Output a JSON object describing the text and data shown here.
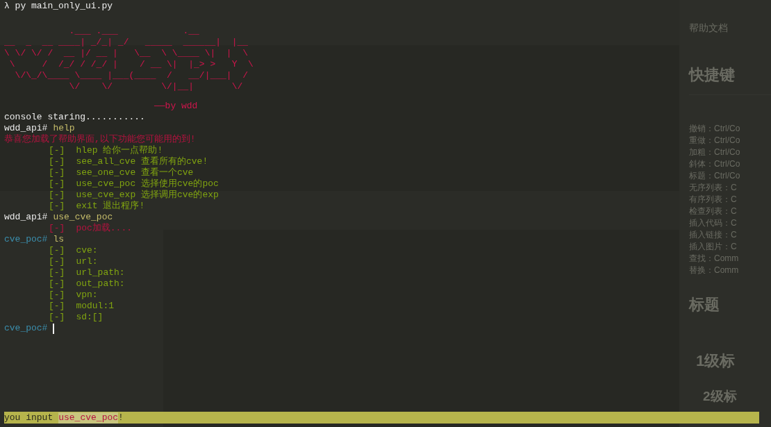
{
  "command": "λ py main_only_ui.py",
  "banner_art": [
    "            .___ .___            .__",
    "__  _  __ ____| _/_| _/   _____  ______|  |__",
    "\\ \\/ \\/ /  __ |/ __ |   \\__  \\ \\____ \\|  |  \\",
    " \\     /  /_/ / /_/ |    / __ \\|  |_> >   Y  \\",
    "  \\/\\_/\\____ \\____ |___(____  /   __/|___|  /",
    "            \\/    \\/         \\/|__|       \\/"
  ],
  "banner_credit": "——by wdd",
  "lines": [
    {
      "kind": "plain",
      "text": "console staring..........."
    },
    {
      "kind": "prompt",
      "color": "#ececec",
      "prompt": "wdd_api#",
      "input": "help"
    },
    {
      "kind": "notice",
      "text": "恭喜您加载了帮助界面,以下功能您可能用的到!"
    },
    {
      "kind": "item",
      "color": "#80a410",
      "marker": "[-]",
      "text": "hlep 给你一点帮助!"
    },
    {
      "kind": "item",
      "color": "#80a410",
      "marker": "[-]",
      "text": "see_all_cve 查看所有的cve!"
    },
    {
      "kind": "item",
      "color": "#80a410",
      "marker": "[-]",
      "text": "see_one_cve 查看一个cve"
    },
    {
      "kind": "item",
      "color": "#80a410",
      "marker": "[-]",
      "text": "use_cve_poc 选择使用cve的poc"
    },
    {
      "kind": "item",
      "color": "#80a410",
      "marker": "[-]",
      "text": "use_cve_exp 选择调用cve的exp"
    },
    {
      "kind": "item",
      "color": "#80a410",
      "marker": "[-]",
      "text": "exit 退出程序!"
    },
    {
      "kind": "prompt",
      "color": "#ececec",
      "prompt": "wdd_api#",
      "input": "use_cve_poc"
    },
    {
      "kind": "item",
      "color": "#b5123f",
      "marker": "[-]",
      "text": "poc加载...."
    },
    {
      "kind": "prompt",
      "color": "#3b8fae",
      "prompt": "cve_poc#",
      "input": "ls"
    },
    {
      "kind": "item",
      "color": "#80a410",
      "marker": "[-]",
      "text": "cve:"
    },
    {
      "kind": "item",
      "color": "#80a410",
      "marker": "[-]",
      "text": "url:"
    },
    {
      "kind": "item",
      "color": "#80a410",
      "marker": "[-]",
      "text": "url_path:"
    },
    {
      "kind": "item",
      "color": "#80a410",
      "marker": "[-]",
      "text": "out_path:"
    },
    {
      "kind": "item",
      "color": "#80a410",
      "marker": "[-]",
      "text": "vpn:"
    },
    {
      "kind": "item",
      "color": "#80a410",
      "marker": "[-]",
      "text": "modul:1"
    },
    {
      "kind": "item",
      "color": "#80a410",
      "marker": "[-]",
      "text": "sd:[]"
    },
    {
      "kind": "cursor_prompt",
      "color": "#3b8fae",
      "prompt": "cve_poc#"
    }
  ],
  "status_bar": {
    "label": "you input",
    "value": "use_cve_poc",
    "suffix": "!"
  },
  "background_window": {
    "title": "帮助文档",
    "heading": "快捷键",
    "shortcuts": [
      "撤销：Ctrl/Co",
      "重做：Ctrl/Co",
      "加粗：Ctrl/Co",
      "斜体：Ctrl/Co",
      "标题：Ctrl/Co",
      "无序列表：C",
      "有序列表：C",
      "检查列表：C",
      "插入代码：C",
      "插入链接：C",
      "插入图片：C",
      "查找：Comm",
      "替换：Comm"
    ],
    "heading_2": "标题",
    "level_1": "1级标",
    "level_2": "2级标"
  }
}
